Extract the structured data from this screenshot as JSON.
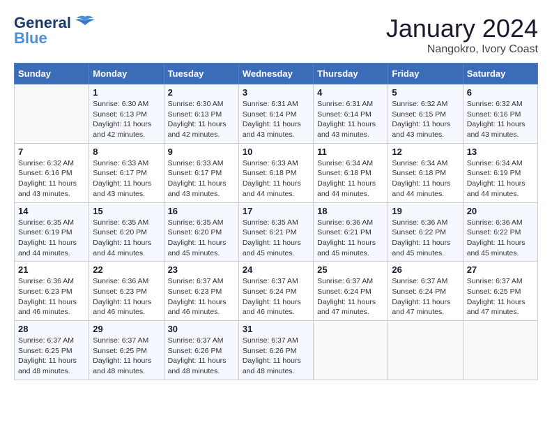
{
  "logo": {
    "part1": "General",
    "part2": "Blue"
  },
  "title": "January 2024",
  "subtitle": "Nangokro, Ivory Coast",
  "days_of_week": [
    "Sunday",
    "Monday",
    "Tuesday",
    "Wednesday",
    "Thursday",
    "Friday",
    "Saturday"
  ],
  "weeks": [
    [
      {
        "day": "",
        "sunrise": "",
        "sunset": "",
        "daylight": ""
      },
      {
        "day": "1",
        "sunrise": "Sunrise: 6:30 AM",
        "sunset": "Sunset: 6:13 PM",
        "daylight": "Daylight: 11 hours and 42 minutes."
      },
      {
        "day": "2",
        "sunrise": "Sunrise: 6:30 AM",
        "sunset": "Sunset: 6:13 PM",
        "daylight": "Daylight: 11 hours and 42 minutes."
      },
      {
        "day": "3",
        "sunrise": "Sunrise: 6:31 AM",
        "sunset": "Sunset: 6:14 PM",
        "daylight": "Daylight: 11 hours and 43 minutes."
      },
      {
        "day": "4",
        "sunrise": "Sunrise: 6:31 AM",
        "sunset": "Sunset: 6:14 PM",
        "daylight": "Daylight: 11 hours and 43 minutes."
      },
      {
        "day": "5",
        "sunrise": "Sunrise: 6:32 AM",
        "sunset": "Sunset: 6:15 PM",
        "daylight": "Daylight: 11 hours and 43 minutes."
      },
      {
        "day": "6",
        "sunrise": "Sunrise: 6:32 AM",
        "sunset": "Sunset: 6:16 PM",
        "daylight": "Daylight: 11 hours and 43 minutes."
      }
    ],
    [
      {
        "day": "7",
        "sunrise": "Sunrise: 6:32 AM",
        "sunset": "Sunset: 6:16 PM",
        "daylight": "Daylight: 11 hours and 43 minutes."
      },
      {
        "day": "8",
        "sunrise": "Sunrise: 6:33 AM",
        "sunset": "Sunset: 6:17 PM",
        "daylight": "Daylight: 11 hours and 43 minutes."
      },
      {
        "day": "9",
        "sunrise": "Sunrise: 6:33 AM",
        "sunset": "Sunset: 6:17 PM",
        "daylight": "Daylight: 11 hours and 43 minutes."
      },
      {
        "day": "10",
        "sunrise": "Sunrise: 6:33 AM",
        "sunset": "Sunset: 6:18 PM",
        "daylight": "Daylight: 11 hours and 44 minutes."
      },
      {
        "day": "11",
        "sunrise": "Sunrise: 6:34 AM",
        "sunset": "Sunset: 6:18 PM",
        "daylight": "Daylight: 11 hours and 44 minutes."
      },
      {
        "day": "12",
        "sunrise": "Sunrise: 6:34 AM",
        "sunset": "Sunset: 6:18 PM",
        "daylight": "Daylight: 11 hours and 44 minutes."
      },
      {
        "day": "13",
        "sunrise": "Sunrise: 6:34 AM",
        "sunset": "Sunset: 6:19 PM",
        "daylight": "Daylight: 11 hours and 44 minutes."
      }
    ],
    [
      {
        "day": "14",
        "sunrise": "Sunrise: 6:35 AM",
        "sunset": "Sunset: 6:19 PM",
        "daylight": "Daylight: 11 hours and 44 minutes."
      },
      {
        "day": "15",
        "sunrise": "Sunrise: 6:35 AM",
        "sunset": "Sunset: 6:20 PM",
        "daylight": "Daylight: 11 hours and 44 minutes."
      },
      {
        "day": "16",
        "sunrise": "Sunrise: 6:35 AM",
        "sunset": "Sunset: 6:20 PM",
        "daylight": "Daylight: 11 hours and 45 minutes."
      },
      {
        "day": "17",
        "sunrise": "Sunrise: 6:35 AM",
        "sunset": "Sunset: 6:21 PM",
        "daylight": "Daylight: 11 hours and 45 minutes."
      },
      {
        "day": "18",
        "sunrise": "Sunrise: 6:36 AM",
        "sunset": "Sunset: 6:21 PM",
        "daylight": "Daylight: 11 hours and 45 minutes."
      },
      {
        "day": "19",
        "sunrise": "Sunrise: 6:36 AM",
        "sunset": "Sunset: 6:22 PM",
        "daylight": "Daylight: 11 hours and 45 minutes."
      },
      {
        "day": "20",
        "sunrise": "Sunrise: 6:36 AM",
        "sunset": "Sunset: 6:22 PM",
        "daylight": "Daylight: 11 hours and 45 minutes."
      }
    ],
    [
      {
        "day": "21",
        "sunrise": "Sunrise: 6:36 AM",
        "sunset": "Sunset: 6:23 PM",
        "daylight": "Daylight: 11 hours and 46 minutes."
      },
      {
        "day": "22",
        "sunrise": "Sunrise: 6:36 AM",
        "sunset": "Sunset: 6:23 PM",
        "daylight": "Daylight: 11 hours and 46 minutes."
      },
      {
        "day": "23",
        "sunrise": "Sunrise: 6:37 AM",
        "sunset": "Sunset: 6:23 PM",
        "daylight": "Daylight: 11 hours and 46 minutes."
      },
      {
        "day": "24",
        "sunrise": "Sunrise: 6:37 AM",
        "sunset": "Sunset: 6:24 PM",
        "daylight": "Daylight: 11 hours and 46 minutes."
      },
      {
        "day": "25",
        "sunrise": "Sunrise: 6:37 AM",
        "sunset": "Sunset: 6:24 PM",
        "daylight": "Daylight: 11 hours and 47 minutes."
      },
      {
        "day": "26",
        "sunrise": "Sunrise: 6:37 AM",
        "sunset": "Sunset: 6:24 PM",
        "daylight": "Daylight: 11 hours and 47 minutes."
      },
      {
        "day": "27",
        "sunrise": "Sunrise: 6:37 AM",
        "sunset": "Sunset: 6:25 PM",
        "daylight": "Daylight: 11 hours and 47 minutes."
      }
    ],
    [
      {
        "day": "28",
        "sunrise": "Sunrise: 6:37 AM",
        "sunset": "Sunset: 6:25 PM",
        "daylight": "Daylight: 11 hours and 48 minutes."
      },
      {
        "day": "29",
        "sunrise": "Sunrise: 6:37 AM",
        "sunset": "Sunset: 6:25 PM",
        "daylight": "Daylight: 11 hours and 48 minutes."
      },
      {
        "day": "30",
        "sunrise": "Sunrise: 6:37 AM",
        "sunset": "Sunset: 6:26 PM",
        "daylight": "Daylight: 11 hours and 48 minutes."
      },
      {
        "day": "31",
        "sunrise": "Sunrise: 6:37 AM",
        "sunset": "Sunset: 6:26 PM",
        "daylight": "Daylight: 11 hours and 48 minutes."
      },
      {
        "day": "",
        "sunrise": "",
        "sunset": "",
        "daylight": ""
      },
      {
        "day": "",
        "sunrise": "",
        "sunset": "",
        "daylight": ""
      },
      {
        "day": "",
        "sunrise": "",
        "sunset": "",
        "daylight": ""
      }
    ]
  ]
}
